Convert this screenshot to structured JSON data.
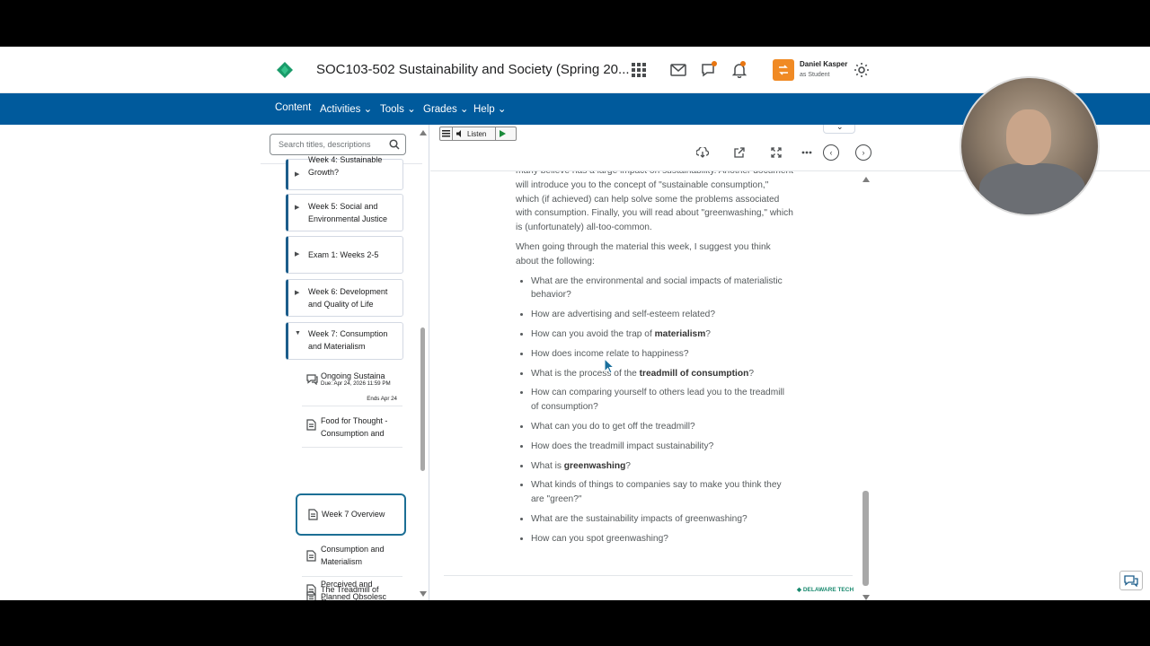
{
  "header": {
    "course_title": "SOC103-502 Sustainability and Society (Spring 20...",
    "user_name": "Daniel Kasper",
    "user_role": "as Student"
  },
  "nav": {
    "items": [
      {
        "label": "Content"
      },
      {
        "label": "Activities"
      },
      {
        "label": "Tools"
      },
      {
        "label": "Grades"
      },
      {
        "label": "Help"
      }
    ]
  },
  "toc": {
    "search_placeholder": "Search titles, descriptions",
    "units": [
      {
        "label": "Week 4: Sustainable Growth?"
      },
      {
        "label": "Week 5: Social and Environmental Justice"
      },
      {
        "label": "Exam 1: Weeks 2-5"
      },
      {
        "label": "Week 6: Development and Quality of Life"
      },
      {
        "label": "Week 7: Consumption and Materialism"
      }
    ],
    "topics": [
      {
        "label": "Ongoing Sustaina",
        "due": "Due: Apr 24, 2026 11:59 PM",
        "ends": "Ends Apr 24"
      },
      {
        "label": "Food for Thought - Consumption and"
      },
      {
        "label": "Week 7 Overview"
      },
      {
        "label": "Consumption and Materialism"
      },
      {
        "label": "The Treadmill of Consumption"
      },
      {
        "label": "Perceived and Planned Obsolesc"
      }
    ]
  },
  "viewer": {
    "listen_label": "Listen"
  },
  "document": {
    "intro_partial": "many believe has a large impact on sustainability. Another document will introduce you to the concept of \"sustainable consumption,\" which (if achieved) can help solve some the problems associated with consumption. Finally, you will read about \"greenwashing,\" which is (unfortunately) all-too-common.",
    "lead": "When going through the material this week, I suggest you think about the following:",
    "questions": [
      {
        "pre": "What are the environmental and social impacts of materialistic behavior?",
        "bold": "",
        "post": ""
      },
      {
        "pre": "How are advertising and self-esteem related?",
        "bold": "",
        "post": ""
      },
      {
        "pre": "How can you avoid the trap of ",
        "bold": "materialism",
        "post": "?"
      },
      {
        "pre": "How does income relate to happiness?",
        "bold": "",
        "post": ""
      },
      {
        "pre": "What is the process of the ",
        "bold": "treadmill of consumption",
        "post": "?"
      },
      {
        "pre": "How can comparing yourself to others lead you to the treadmill of consumption?",
        "bold": "",
        "post": ""
      },
      {
        "pre": "What can you do to get off the treadmill?",
        "bold": "",
        "post": ""
      },
      {
        "pre": "How does the treadmill impact sustainability?",
        "bold": "",
        "post": ""
      },
      {
        "pre": "What is ",
        "bold": "greenwashing",
        "post": "?"
      },
      {
        "pre": "What kinds of things to companies say to make you think they are \"green?\"",
        "bold": "",
        "post": ""
      },
      {
        "pre": "What are the sustainability impacts of greenwashing?",
        "bold": "",
        "post": ""
      },
      {
        "pre": "How can you spot greenwashing?",
        "bold": "",
        "post": ""
      }
    ],
    "footer_logo": "DELAWARE TECH"
  },
  "colors": {
    "nav_bg": "#005a9c",
    "accent": "#1c6f95",
    "avatar": "#f08a24",
    "logo_green": "#1a9b6a"
  }
}
